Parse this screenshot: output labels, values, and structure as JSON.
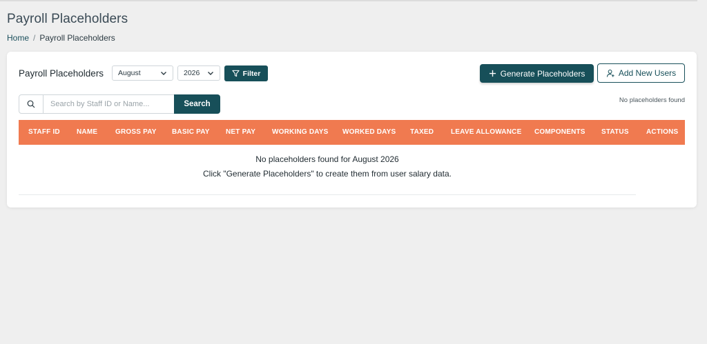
{
  "page": {
    "title": "Payroll Placeholders",
    "breadcrumb": {
      "home": "Home",
      "separator": "/",
      "current": "Payroll Placeholders"
    }
  },
  "card": {
    "title": "Payroll Placeholders",
    "month_select": {
      "value": "August"
    },
    "year_select": {
      "value": "2026"
    },
    "filter_label": "Filter",
    "generate_label": "Generate Placeholders",
    "add_users_label": "Add New Users",
    "search": {
      "placeholder": "Search by Staff ID or Name...",
      "value": "",
      "button_label": "Search"
    },
    "status_text": "No placeholders found"
  },
  "table": {
    "columns": [
      "STAFF ID",
      "NAME",
      "GROSS PAY",
      "BASIC PAY",
      "NET PAY",
      "WORKING DAYS",
      "WORKED DAYS",
      "TAXED",
      "LEAVE ALLOWANCE",
      "COMPONENTS",
      "STATUS",
      "ACTIONS"
    ],
    "empty_title": "No placeholders found for August 2026",
    "empty_hint": "Click \"Generate Placeholders\" to create them from user salary data."
  },
  "colors": {
    "primary": "#174f59",
    "table_header": "#f07a50",
    "background": "#efefef"
  },
  "icons": [
    "chevron-down-icon",
    "filter-icon",
    "plus-icon",
    "add-user-icon",
    "search-icon"
  ]
}
